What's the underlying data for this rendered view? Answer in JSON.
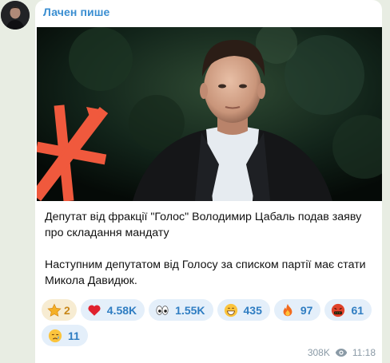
{
  "channel": {
    "name": "Лачен пише"
  },
  "post": {
    "paragraphs": [
      "Депутат від фракції \"Голос\" Володимир Цабаль подав заяву про складання мандату",
      "Наступним депутатом від Голосу за списком партії має стати Микола Давидюк."
    ]
  },
  "reactions": [
    {
      "icon": "star-icon",
      "count": "2"
    },
    {
      "icon": "heart-icon",
      "count": "4.58K"
    },
    {
      "icon": "eyes-icon",
      "count": "1.55K"
    },
    {
      "icon": "grin-icon",
      "count": "435"
    },
    {
      "icon": "fire-icon",
      "count": "97"
    },
    {
      "icon": "cursing-face-icon",
      "count": "61"
    },
    {
      "icon": "crying-face-icon",
      "count": "11"
    }
  ],
  "meta": {
    "views": "308K",
    "time": "11:18"
  },
  "colors": {
    "accent": "#3a8ed1",
    "reaction_bg": "#e4effa",
    "brand_mark": "#f0593d"
  }
}
